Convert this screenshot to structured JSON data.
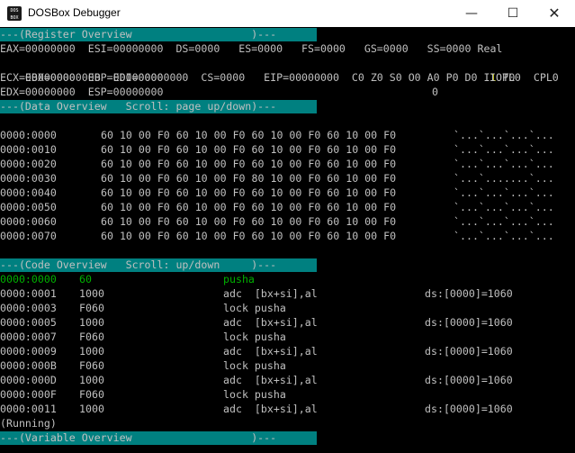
{
  "window": {
    "title": "DOSBox Debugger",
    "icon_text_top": "DOS",
    "icon_text_bottom": "BOX",
    "icon_name": "dosbox-icon",
    "minimize": "—",
    "maximize": "☐",
    "close": "✕"
  },
  "colors": {
    "background": "#000000",
    "text": "#c0c0c0",
    "section_header_bg": "#008080",
    "current_instruction": "#00b000"
  },
  "registers": {
    "header": "---(Register Overview                   )---",
    "row1": "EAX=00000000  ESI=00000000  DS=0000   ES=0000   FS=0000   GS=0000   SS=0000 Real",
    "row2a": "EBX=00000000  EDI=00000000  CS=0000   EIP=00000000  C0 Z0 S0 O0 A0 P0 D0 I",
    "row2_flag": "1",
    "row2b": " T0",
    "row3a": "ECX=00000000  EBP=00000000",
    "row3b": "IOPL0  CPL0",
    "row4a": "EDX=00000000  ESP=00000000",
    "row4b": "0"
  },
  "data_overview": {
    "header": "---(Data Overview   Scroll: page up/down)---",
    "rows": [
      {
        "addr": "0000:0000",
        "hex": "60 10 00 F0 60 10 00 F0 60 10 00 F0 60 10 00 F0",
        "ascii": "`...`...`...`..."
      },
      {
        "addr": "0000:0010",
        "hex": "60 10 00 F0 60 10 00 F0 60 10 00 F0 60 10 00 F0",
        "ascii": "`...`...`...`..."
      },
      {
        "addr": "0000:0020",
        "hex": "60 10 00 F0 60 10 00 F0 60 10 00 F0 60 10 00 F0",
        "ascii": "`...`...`...`..."
      },
      {
        "addr": "0000:0030",
        "hex": "60 10 00 F0 60 10 00 F0 80 10 00 F0 60 10 00 F0",
        "ascii": "`...`.......`..."
      },
      {
        "addr": "0000:0040",
        "hex": "60 10 00 F0 60 10 00 F0 60 10 00 F0 60 10 00 F0",
        "ascii": "`...`...`...`..."
      },
      {
        "addr": "0000:0050",
        "hex": "60 10 00 F0 60 10 00 F0 60 10 00 F0 60 10 00 F0",
        "ascii": "`...`...`...`..."
      },
      {
        "addr": "0000:0060",
        "hex": "60 10 00 F0 60 10 00 F0 60 10 00 F0 60 10 00 F0",
        "ascii": "`...`...`...`..."
      },
      {
        "addr": "0000:0070",
        "hex": "60 10 00 F0 60 10 00 F0 60 10 00 F0 60 10 00 F0",
        "ascii": "`...`...`...`..."
      }
    ]
  },
  "code_overview": {
    "header": "---(Code Overview   Scroll: up/down     )---",
    "rows": [
      {
        "addr": "0000:0000",
        "bytes": "60",
        "instr": "pusha",
        "extra": "",
        "current": true
      },
      {
        "addr": "0000:0001",
        "bytes": "1000",
        "instr": "adc  [bx+si],al",
        "extra": "ds:[0000]=1060",
        "current": false
      },
      {
        "addr": "0000:0003",
        "bytes": "F060",
        "instr": "lock pusha",
        "extra": "",
        "current": false
      },
      {
        "addr": "0000:0005",
        "bytes": "1000",
        "instr": "adc  [bx+si],al",
        "extra": "ds:[0000]=1060",
        "current": false
      },
      {
        "addr": "0000:0007",
        "bytes": "F060",
        "instr": "lock pusha",
        "extra": "",
        "current": false
      },
      {
        "addr": "0000:0009",
        "bytes": "1000",
        "instr": "adc  [bx+si],al",
        "extra": "ds:[0000]=1060",
        "current": false
      },
      {
        "addr": "0000:000B",
        "bytes": "F060",
        "instr": "lock pusha",
        "extra": "",
        "current": false
      },
      {
        "addr": "0000:000D",
        "bytes": "1000",
        "instr": "adc  [bx+si],al",
        "extra": "ds:[0000]=1060",
        "current": false
      },
      {
        "addr": "0000:000F",
        "bytes": "F060",
        "instr": "lock pusha",
        "extra": "",
        "current": false
      },
      {
        "addr": "0000:0011",
        "bytes": "1000",
        "instr": "adc  [bx+si],al",
        "extra": "ds:[0000]=1060",
        "current": false
      }
    ]
  },
  "status": "(Running)",
  "variable_overview": {
    "header": "---(Variable Overview                   )---"
  }
}
